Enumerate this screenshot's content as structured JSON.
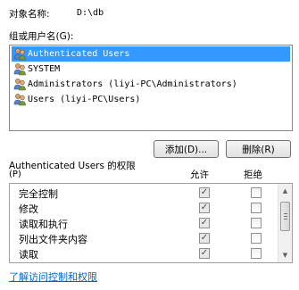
{
  "object": {
    "label": "对象名称:",
    "value": "D:\\db"
  },
  "groups": {
    "label": "组或用户名(G):",
    "items": [
      {
        "name": "Authenticated Users",
        "selected": true,
        "icon": "users-icon"
      },
      {
        "name": "SYSTEM",
        "selected": false,
        "icon": "users-icon"
      },
      {
        "name": "Administrators (liyi-PC\\Administrators)",
        "selected": false,
        "icon": "users-icon"
      },
      {
        "name": "Users (liyi-PC\\Users)",
        "selected": false,
        "icon": "users-icon"
      }
    ]
  },
  "buttons": {
    "add": "添加(D)...",
    "remove": "删除(R)"
  },
  "permissions": {
    "title_line1": "Authenticated Users 的权限",
    "title_line2": "(P)",
    "allow_header": "允许",
    "deny_header": "拒绝",
    "rows": [
      {
        "name": "完全控制",
        "allow": true,
        "deny": false
      },
      {
        "name": "修改",
        "allow": true,
        "deny": false
      },
      {
        "name": "读取和执行",
        "allow": true,
        "deny": false
      },
      {
        "name": "列出文件夹内容",
        "allow": true,
        "deny": false
      },
      {
        "name": "读取",
        "allow": true,
        "deny": false
      }
    ]
  },
  "help_link": "了解访问控制和权限",
  "colors": {
    "selection": "#3399ff",
    "link": "#0066cc"
  }
}
